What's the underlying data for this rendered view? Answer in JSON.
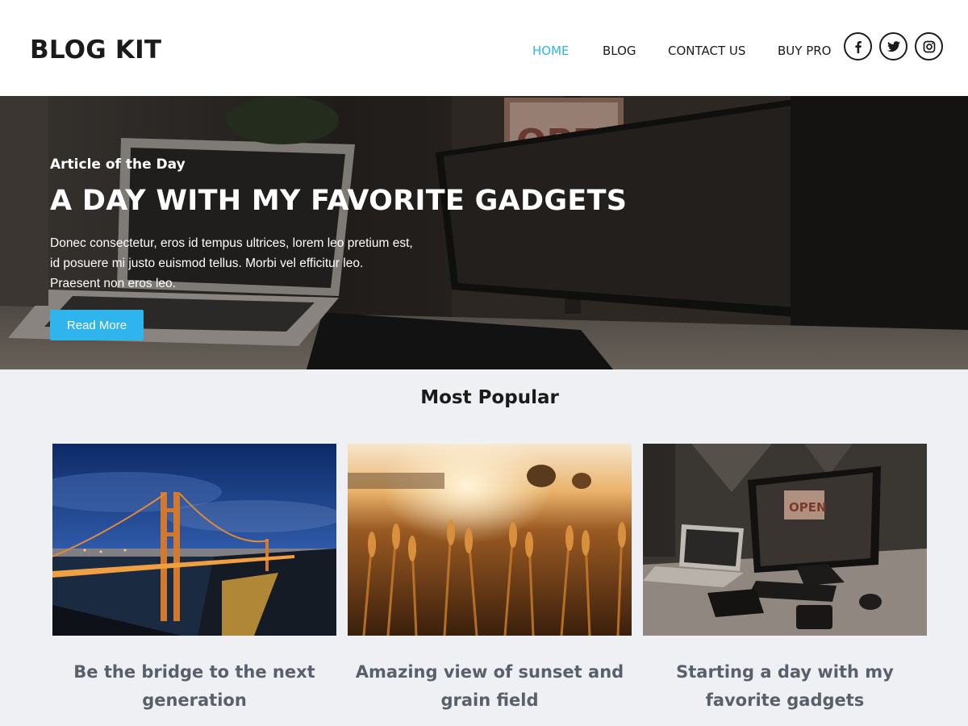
{
  "header": {
    "logo": "BLOG KIT",
    "nav": [
      {
        "label": "HOME",
        "active": true
      },
      {
        "label": "BLOG",
        "active": false
      },
      {
        "label": "CONTACT US",
        "active": false
      },
      {
        "label": "BUY PRO",
        "active": false
      }
    ],
    "social": [
      "facebook-icon",
      "twitter-icon",
      "instagram-icon"
    ]
  },
  "hero": {
    "kicker": "Article of the Day",
    "title": "A DAY WITH MY FAVORITE GADGETS",
    "lines": [
      "Donec consectetur, eros id tempus ultrices, lorem leo pretium est,",
      "id posuere mi justo euismod tellus. Morbi vel efficitur leo.",
      "Praesent non eros leo."
    ],
    "button": "Read More",
    "sign_text": "OPEN"
  },
  "popular": {
    "title": "Most Popular",
    "cards": [
      {
        "title": "Be the bridge to the next generation"
      },
      {
        "title": "Amazing view of sunset and grain field"
      },
      {
        "title": "Starting a day with my favorite gadgets"
      }
    ]
  },
  "colors": {
    "accent": "#2fb4ee",
    "card_title": "#59606b",
    "section_bg": "#eff0f3"
  }
}
